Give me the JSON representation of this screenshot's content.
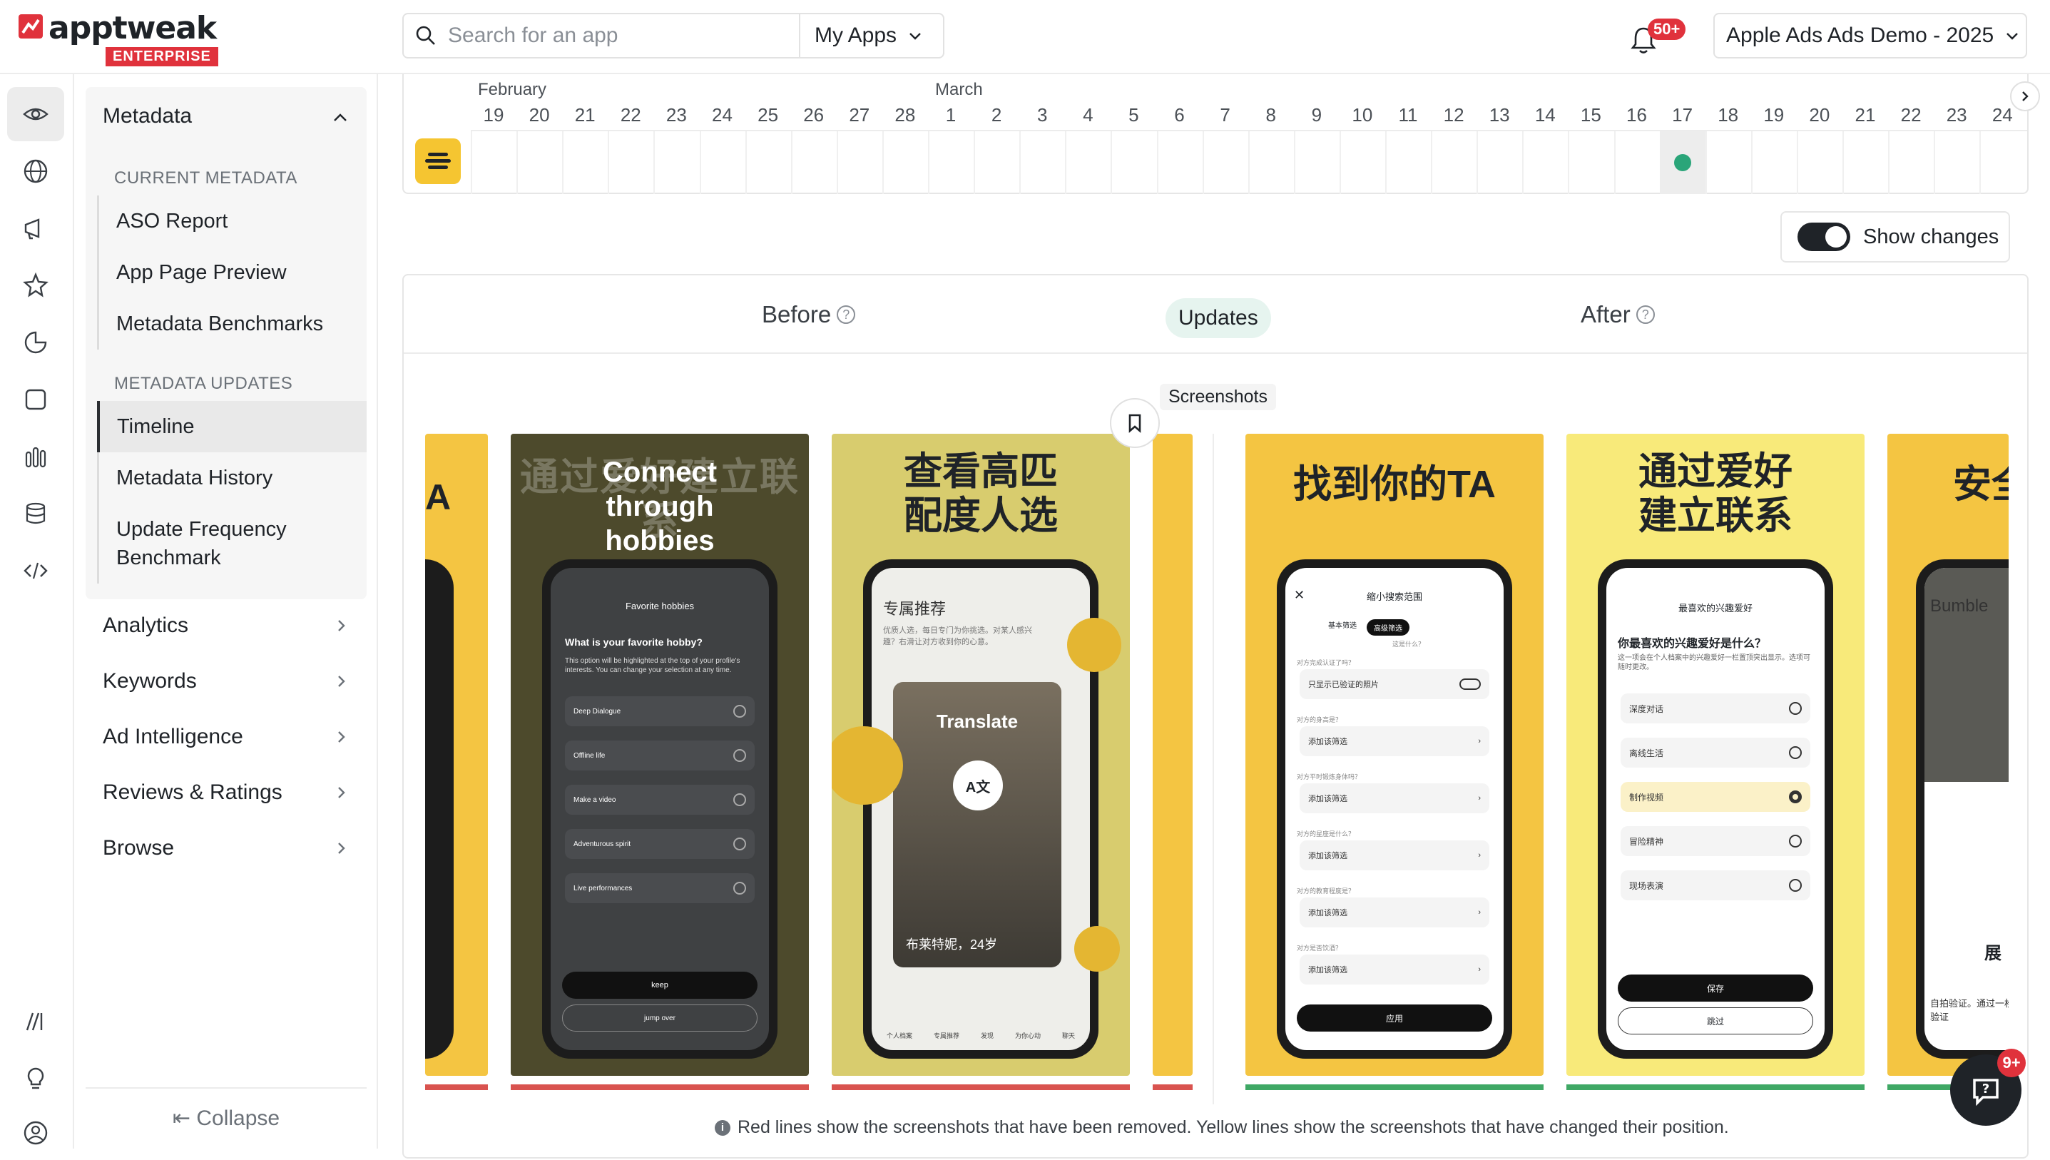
{
  "brand": {
    "name": "apptweak",
    "tier": "ENTERPRISE",
    "accent": "#e0323c"
  },
  "header": {
    "search_placeholder": "Search for an app",
    "apps_filter": "My Apps",
    "notifications_badge": "50+",
    "account": "Apple Ads Ads Demo - 2025"
  },
  "rail_icons": [
    "eye-icon",
    "globe-icon",
    "megaphone-icon",
    "star-icon",
    "pie-chart-icon",
    "square-icon",
    "bar-chart-icon",
    "database-icon",
    "code-icon",
    "slashes-icon",
    "lightbulb-icon",
    "user-circle-icon"
  ],
  "sidebar": {
    "metadata_title": "Metadata",
    "current_section": "CURRENT METADATA",
    "current_items": [
      "ASO Report",
      "App Page Preview",
      "Metadata Benchmarks"
    ],
    "updates_section": "METADATA UPDATES",
    "updates_items": [
      "Timeline",
      "Metadata History",
      "Update Frequency Benchmark"
    ],
    "selected": "Timeline",
    "groups": [
      "Analytics",
      "Keywords",
      "Ad Intelligence",
      "Reviews & Ratings",
      "Browse"
    ],
    "collapse": "Collapse"
  },
  "timeline": {
    "months": [
      {
        "label": "February",
        "day_index": 0
      },
      {
        "label": "March",
        "day_index": 10
      }
    ],
    "days": [
      "19",
      "20",
      "21",
      "22",
      "23",
      "24",
      "25",
      "26",
      "27",
      "28",
      "1",
      "2",
      "3",
      "4",
      "5",
      "6",
      "7",
      "8",
      "9",
      "10",
      "11",
      "12",
      "13",
      "14",
      "15",
      "16",
      "17",
      "18",
      "19",
      "20",
      "21",
      "22",
      "23",
      "24"
    ],
    "highlight_day_index": 26,
    "update_dot_color": "#2aa579"
  },
  "controls": {
    "show_changes": "Show changes",
    "show_changes_on": true
  },
  "compare": {
    "before": "Before",
    "updates": "Updates",
    "after": "After",
    "section": "Screenshots",
    "note": "Red lines show the screenshots that have been removed. Yellow lines show the screenshots that have changed their position."
  },
  "before_shots": [
    {
      "caption": "Connect through hobbies",
      "caption_bg": "通过爱好建立联系",
      "screen_title": "Favorite hobbies",
      "question": "What is your favorite hobby?",
      "sub": "This option will be highlighted at the top of your profile's interests. You can change your selection at any time.",
      "options": [
        "Deep Dialogue",
        "Offline life",
        "Make a video",
        "Adventurous spirit",
        "Live performances"
      ],
      "primary": "keep",
      "secondary": "jump over"
    },
    {
      "caption": "查看高匹配度人选",
      "screen_title": "专属推荐",
      "sub": "优质人选，每日专门为你挑选。对某人感兴趣？右滑让对方收到你的心意。",
      "overlay": "Translate",
      "person": "布莱特妮，24岁",
      "tabs": [
        "个人档案",
        "专属推荐",
        "发现",
        "为你心动",
        "聊天"
      ]
    }
  ],
  "after_shots": [
    {
      "caption": "找到你的TA",
      "screen_title": "缩小搜索范围",
      "seg": [
        "基本筛选",
        "高级筛选"
      ],
      "q": [
        "对方完成认证了吗？",
        "对方的身高是？",
        "对方平时锻炼身体吗？",
        "对方的星座是什么？",
        "对方的教育程度是？",
        "对方是否饮酒？"
      ],
      "toggle_row": "只显示已验证的照片",
      "add_row": "添加该筛选",
      "primary": "应用",
      "hint": "这是什么？"
    },
    {
      "caption": "通过爱好建立联系",
      "screen_title": "最喜欢的兴趣爱好",
      "question": "你最喜欢的兴趣爱好是什么？",
      "sub": "这一项会在个人档案中的兴趣爱好一栏置顶突出显示。选项可随时更改。",
      "options": [
        "深度对话",
        "离线生活",
        "制作视频",
        "冒险精神",
        "现场表演"
      ],
      "selected": 2,
      "primary": "保存",
      "secondary": "跳过"
    },
    {
      "caption": "安全",
      "brand": "Bumble",
      "body": "自拍验证。通过一枚验证",
      "label": "展"
    }
  ],
  "chat_badge": "9+"
}
